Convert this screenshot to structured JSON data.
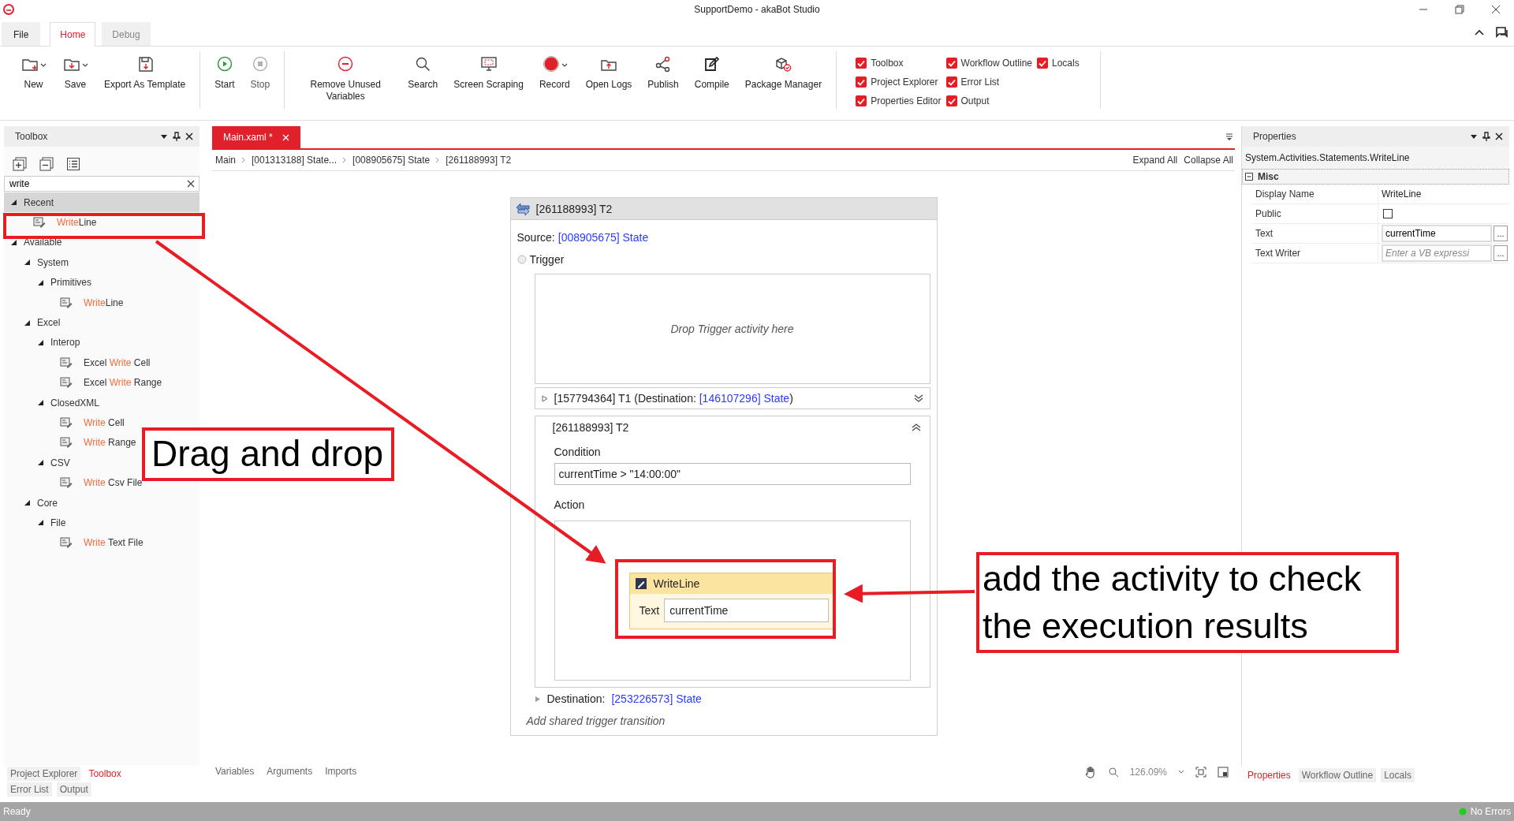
{
  "window": {
    "title": "SupportDemo - akaBot Studio"
  },
  "ribbon": {
    "tabs": [
      {
        "label": "File",
        "selected": false
      },
      {
        "label": "Home",
        "selected": true
      },
      {
        "label": "Debug",
        "selected": false
      }
    ],
    "groups": [
      {
        "kind": "buttons",
        "buttons": [
          {
            "label": "New",
            "dropdown": true
          },
          {
            "label": "Save",
            "dropdown": true
          },
          {
            "label": "Export As Template",
            "dropdown": false
          }
        ]
      },
      {
        "kind": "buttons",
        "buttons": [
          {
            "label": "Start",
            "dropdown": false,
            "disabled": false
          },
          {
            "label": "Stop",
            "dropdown": false,
            "disabled": true
          }
        ]
      },
      {
        "kind": "buttons",
        "buttons": [
          {
            "label": "Remove Unused Variables",
            "dropdown": false
          },
          {
            "label": "Search",
            "dropdown": false
          },
          {
            "label": "Screen Scraping",
            "dropdown": false
          },
          {
            "label": "Record",
            "dropdown": true
          },
          {
            "label": "Open Logs",
            "dropdown": false
          },
          {
            "label": "Publish",
            "dropdown": false
          },
          {
            "label": "Compile",
            "dropdown": false
          },
          {
            "label": "Package Manager",
            "dropdown": false
          }
        ]
      },
      {
        "kind": "checks",
        "checks": [
          {
            "label": "Toolbox",
            "checked": true
          },
          {
            "label": "Project Explorer",
            "checked": true
          },
          {
            "label": "Properties Editor",
            "checked": true
          },
          {
            "label": "Workflow Outline",
            "checked": true
          },
          {
            "label": "Error List",
            "checked": true
          },
          {
            "label": "Output",
            "checked": true
          },
          {
            "label": "Locals",
            "checked": true
          }
        ]
      }
    ]
  },
  "toolbox": {
    "title": "Toolbox",
    "search": {
      "value": "write"
    },
    "tree": [
      {
        "parts": [
          {
            "text": "Recent",
            "match": false
          }
        ],
        "expanded": true,
        "selected": true,
        "children": [
          {
            "parts": [
              {
                "text": "Write",
                "match": true
              },
              {
                "text": "Line",
                "match": false
              }
            ],
            "selected": false
          }
        ]
      },
      {
        "parts": [
          {
            "text": "Available",
            "match": false
          }
        ],
        "expanded": true,
        "selected": false,
        "children": [
          {
            "parts": [
              {
                "text": "System",
                "match": false
              }
            ],
            "expanded": true,
            "selected": false,
            "children": [
              {
                "parts": [
                  {
                    "text": "Primitives",
                    "match": false
                  }
                ],
                "expanded": true,
                "selected": false,
                "children": [
                  {
                    "parts": [
                      {
                        "text": "Write",
                        "match": true
                      },
                      {
                        "text": "Line",
                        "match": false
                      }
                    ],
                    "selected": false
                  }
                ]
              }
            ]
          },
          {
            "parts": [
              {
                "text": "Excel",
                "match": false
              }
            ],
            "expanded": true,
            "selected": false,
            "children": [
              {
                "parts": [
                  {
                    "text": "Interop",
                    "match": false
                  }
                ],
                "expanded": true,
                "selected": false,
                "children": [
                  {
                    "parts": [
                      {
                        "text": "Excel ",
                        "match": false
                      },
                      {
                        "text": "Write",
                        "match": true
                      },
                      {
                        "text": " Cell",
                        "match": false
                      }
                    ],
                    "selected": false
                  },
                  {
                    "parts": [
                      {
                        "text": "Excel ",
                        "match": false
                      },
                      {
                        "text": "Write",
                        "match": true
                      },
                      {
                        "text": " Range",
                        "match": false
                      }
                    ],
                    "selected": false
                  }
                ]
              },
              {
                "parts": [
                  {
                    "text": "ClosedXML",
                    "match": false
                  }
                ],
                "expanded": true,
                "selected": false,
                "children": [
                  {
                    "parts": [
                      {
                        "text": "Write",
                        "match": true
                      },
                      {
                        "text": " Cell",
                        "match": false
                      }
                    ],
                    "selected": false
                  },
                  {
                    "parts": [
                      {
                        "text": "Write",
                        "match": true
                      },
                      {
                        "text": " Range",
                        "match": false
                      }
                    ],
                    "selected": false
                  }
                ]
              },
              {
                "parts": [
                  {
                    "text": "CSV",
                    "match": false
                  }
                ],
                "expanded": true,
                "selected": false,
                "children": [
                  {
                    "parts": [
                      {
                        "text": "Write",
                        "match": true
                      },
                      {
                        "text": " Csv File",
                        "match": false
                      }
                    ],
                    "selected": false
                  }
                ]
              }
            ]
          },
          {
            "parts": [
              {
                "text": "Core",
                "match": false
              }
            ],
            "expanded": true,
            "selected": false,
            "children": [
              {
                "parts": [
                  {
                    "text": "File",
                    "match": false
                  }
                ],
                "expanded": true,
                "selected": false,
                "children": [
                  {
                    "parts": [
                      {
                        "text": "Write",
                        "match": true
                      },
                      {
                        "text": " Text File",
                        "match": false
                      }
                    ],
                    "selected": false
                  }
                ]
              }
            ]
          }
        ]
      }
    ],
    "bottom_tabs": [
      [
        {
          "label": "Project Explorer",
          "selected": false
        },
        {
          "label": "Toolbox",
          "selected": true
        }
      ],
      [
        {
          "label": "Error List",
          "selected": false
        },
        {
          "label": "Output",
          "selected": false
        }
      ]
    ]
  },
  "designer": {
    "tab": {
      "label": "Main.xaml *",
      "selected": true
    },
    "breadcrumb": [
      "Main",
      "[001313188] State...",
      "[008905675] State",
      "[261188993] T2"
    ],
    "expand_all": "Expand All",
    "collapse_all": "Collapse All",
    "transition": {
      "title": "[261188993] T2",
      "source_label": "Source:",
      "source": "[008905675] State",
      "trigger_label": "Trigger",
      "drop_hint": "Drop Trigger activity here",
      "items": [
        {
          "expanded": false,
          "title": "[157794364] T1 (Destination: ",
          "destination": "[146107296] State",
          "tail": ")"
        },
        {
          "expanded": true,
          "title": "[261188993] T2",
          "condition_label": "Condition",
          "condition": "currentTime > \"14:00:00\"",
          "action_label": "Action",
          "activity": {
            "title": "WriteLine",
            "field_label": "Text",
            "value": "currentTime"
          },
          "destination_label": "Destination:",
          "destination": "[253226573] State"
        }
      ],
      "add_hint": "Add shared trigger transition"
    },
    "bottom_tabs": [
      "Variables",
      "Arguments",
      "Imports"
    ],
    "zoom": "126.09%"
  },
  "properties": {
    "title": "Properties",
    "type": "System.Activities.Statements.WriteLine",
    "category": {
      "label": "Misc",
      "expanded": true
    },
    "rows": [
      {
        "label": "Display Name",
        "kind": "text",
        "value": "WriteLine"
      },
      {
        "label": "Public",
        "kind": "check",
        "checked": false
      },
      {
        "label": "Text",
        "kind": "field",
        "value": "currentTime",
        "button": "..."
      },
      {
        "label": "Text Writer",
        "kind": "field",
        "placeholder": "Enter a VB expressi",
        "button": "..."
      }
    ],
    "bottom_tabs": [
      {
        "label": "Properties",
        "selected": true
      },
      {
        "label": "Workflow Outline",
        "selected": false
      },
      {
        "label": "Locals",
        "selected": false
      }
    ]
  },
  "status_bar": {
    "text": "Ready",
    "errors": "No Errors"
  },
  "annotations": [
    {
      "text": "Drag and drop"
    },
    {
      "text": "add the activity to check the execution results"
    }
  ]
}
